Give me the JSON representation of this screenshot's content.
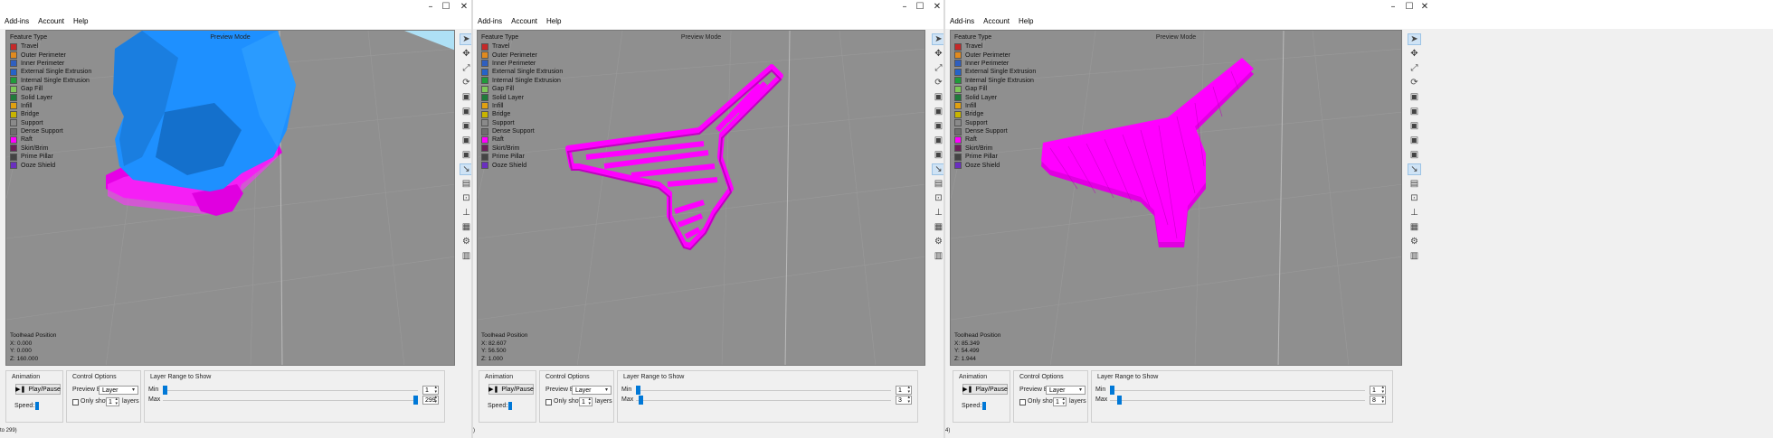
{
  "menu": [
    "Add-ins",
    "Account",
    "Help"
  ],
  "window_controls": {
    "minimize": "–",
    "maximize": "☐",
    "close": "✕"
  },
  "viewport_title": "Preview Mode",
  "legend": {
    "header": "Feature Type",
    "items": [
      {
        "label": "Travel",
        "color": "#c62828"
      },
      {
        "label": "Outer Perimeter",
        "color": "#e08a1e"
      },
      {
        "label": "Inner Perimeter",
        "color": "#2f5fbf"
      },
      {
        "label": "External Single Extrusion",
        "color": "#2563c9"
      },
      {
        "label": "Internal Single Extrusion",
        "color": "#1f9c3a"
      },
      {
        "label": "Gap Fill",
        "color": "#7ec85a"
      },
      {
        "label": "Solid Layer",
        "color": "#1f7a3a"
      },
      {
        "label": "Infill",
        "color": "#e0a010"
      },
      {
        "label": "Bridge",
        "color": "#c8b400"
      },
      {
        "label": "Support",
        "color": "#8a8a8a"
      },
      {
        "label": "Dense Support",
        "color": "#6e6e6e"
      },
      {
        "label": "Raft",
        "color": "#ff00ff"
      },
      {
        "label": "Skirt/Brim",
        "color": "#6b1f5a"
      },
      {
        "label": "Prime Pillar",
        "color": "#444444"
      },
      {
        "label": "Ooze Shield",
        "color": "#6a2fbf"
      }
    ]
  },
  "toolhead_label": "Toolhead Position",
  "animation": {
    "title": "Animation",
    "play_pause": "Play/Pause",
    "speed_label": "Speed:"
  },
  "control": {
    "title": "Control Options",
    "preview_by_label": "Preview By",
    "preview_by_value": "Layer",
    "only_show": "Only show",
    "layers": "layers",
    "only_show_value": "1"
  },
  "layer_range": {
    "title": "Layer Range to Show",
    "min_label": "Min",
    "max_label": "Max"
  },
  "tool_icons": [
    "cursor-icon",
    "move-icon",
    "scale-icon",
    "rotate-icon",
    "view-iso-icon",
    "view-front-icon",
    "view-side-icon",
    "view-top-icon",
    "view-bottom-icon",
    "preview-mode-icon",
    "layer-view-icon",
    "camera-icon",
    "measure-icon",
    "gcode-icon",
    "settings-icon",
    "grid-icon"
  ],
  "windows": [
    {
      "toolhead": {
        "x": "X: 0.000",
        "y": "Y: 0.000",
        "z": "Z: 160.000"
      },
      "layer_min": "1",
      "layer_max": "299",
      "min_fraction": 0.0,
      "max_fraction": 1.0,
      "status": "to 299)"
    },
    {
      "toolhead": {
        "x": "X: 82.607",
        "y": "Y: 56.500",
        "z": "Z: 1.000"
      },
      "layer_min": "1",
      "layer_max": "3",
      "min_fraction": 0.0,
      "max_fraction": 0.01,
      "status": ")"
    },
    {
      "toolhead": {
        "x": "X: 85.349",
        "y": "Y: 54.499",
        "z": "Z: 1.944"
      },
      "layer_min": "1",
      "layer_max": "8",
      "min_fraction": 0.0,
      "max_fraction": 0.03,
      "status": "4)"
    }
  ]
}
